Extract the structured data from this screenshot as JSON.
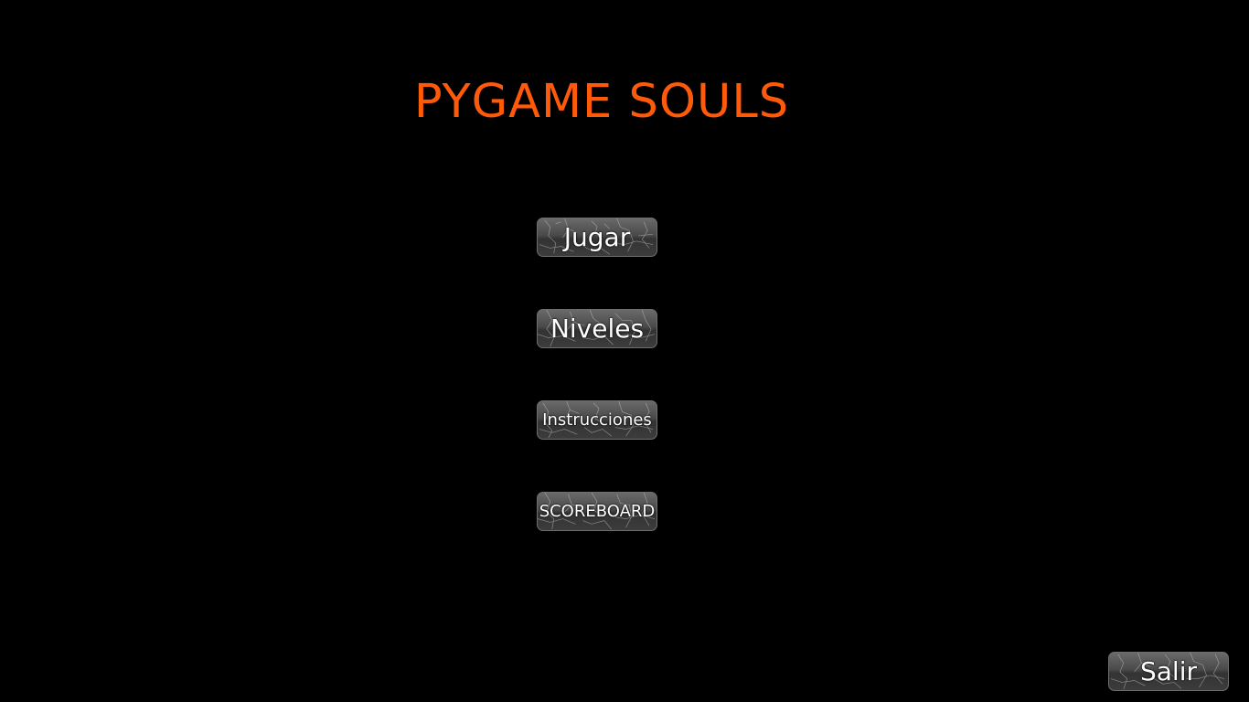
{
  "game": {
    "title": "PYGAME SOULS",
    "title_color": "#ff5a0a",
    "background_color": "#000000"
  },
  "menu": {
    "play_label": "Jugar",
    "levels_label": "Niveles",
    "instructions_label": "Instrucciones",
    "scoreboard_label": "SCOREBOARD"
  },
  "footer": {
    "exit_label": "Salir"
  }
}
